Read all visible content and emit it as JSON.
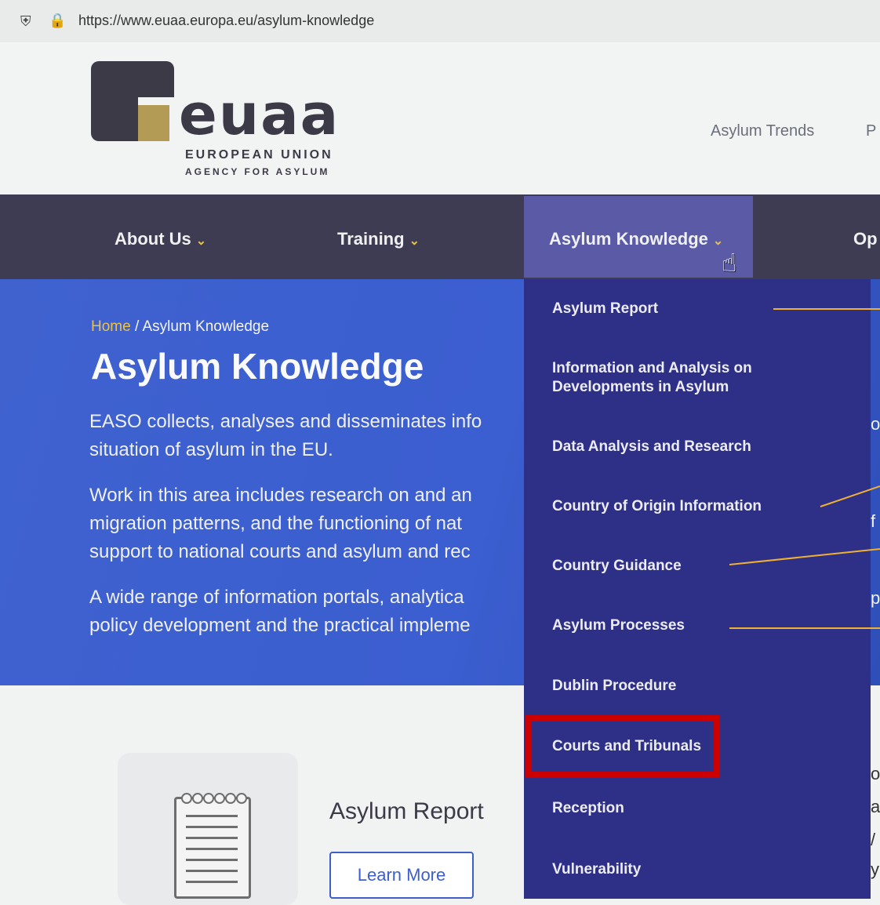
{
  "browser": {
    "url": "https://www.euaa.europa.eu/asylum-knowledge",
    "shield_icon": "⛨",
    "lock_icon": "🔒"
  },
  "logo": {
    "word": "euaa",
    "line1": "EUROPEAN UNION",
    "line2": "AGENCY FOR ASYLUM"
  },
  "top_links": [
    "Asylum Trends",
    "P"
  ],
  "nav": {
    "items": [
      {
        "label": "About Us"
      },
      {
        "label": "Training"
      },
      {
        "label": "Asylum Knowledge"
      },
      {
        "label": "Op"
      }
    ],
    "chevron": "⌄"
  },
  "breadcrumb": {
    "home": "Home",
    "sep": " / ",
    "current": "Asylum Knowledge"
  },
  "hero": {
    "title": "Asylum Knowledge",
    "p1": [
      "EASO collects, analyses and disseminates info",
      "situation of asylum in the EU."
    ],
    "p2": [
      "Work in this area includes research on and an",
      "migration patterns, and the functioning of nat",
      "support to national courts and asylum and rec"
    ],
    "p3": [
      "A wide range of information portals, analytica",
      "policy development and the practical impleme"
    ]
  },
  "dropdown": [
    "Asylum Report",
    "Information and Analysis on Developments in Asylum",
    "Data Analysis and Research",
    "Country of Origin Information",
    "Country Guidance",
    "Asylum Processes",
    "Dublin Procedure",
    "Courts and Tribunals",
    "Reception",
    "Vulnerability"
  ],
  "card": {
    "title": "Asylum Report",
    "button": "Learn More",
    "icon": "notepad-icon"
  },
  "cursor_icon": "☝",
  "right_fragments": [
    "o",
    "f",
    "p",
    "o",
    "a",
    "/",
    "y"
  ],
  "colors": {
    "nav_bg": "#3e3c52",
    "hero_bg": "#3b5ed0",
    "dropdown_bg": "#2e3088",
    "accent_gold": "#e8c24a",
    "highlight_red": "#cc0000",
    "connector": "#f0b030"
  }
}
